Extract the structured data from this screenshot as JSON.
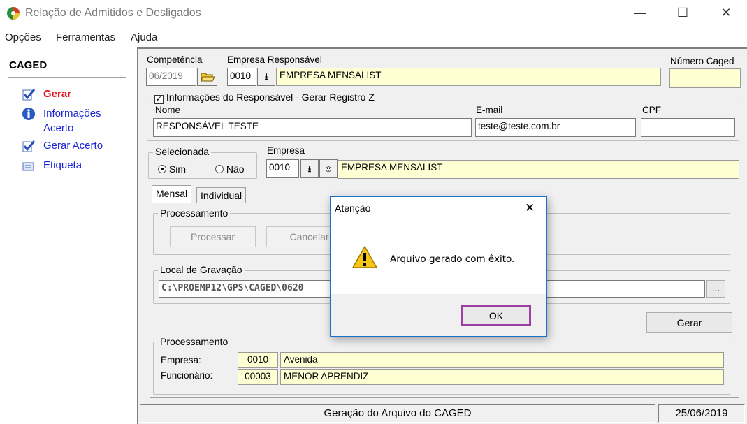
{
  "window": {
    "title": "Relação de Admitidos e Desligados",
    "minimize": "—",
    "maximize": "☐",
    "close": "✕"
  },
  "menu": [
    "Opções",
    "Ferramentas",
    "Ajuda"
  ],
  "sidebar": {
    "title": "CAGED",
    "items": [
      {
        "label": "Gerar",
        "color": "#e0121b"
      },
      {
        "label": "Informações",
        "label2": "Acerto"
      },
      {
        "label": "Gerar Acerto"
      },
      {
        "label": "Etiqueta"
      }
    ]
  },
  "form": {
    "competencia_label": "Competência",
    "competencia_value": "06/2019",
    "empresa_resp_label": "Empresa Responsável",
    "empresa_resp_code": "0010",
    "empresa_resp_name": "EMPRESA MENSALIST",
    "numero_caged_label": "Número Caged",
    "numero_caged_value": "",
    "info_resp_checkbox": "✓",
    "info_resp_label": "Informações do Responsável - Gerar Registro Z",
    "nome_label": "Nome",
    "nome_value": "RESPONSÁVEL TESTE",
    "email_label": "E-mail",
    "email_value": "teste@teste.com.br",
    "cpf_label": "CPF",
    "cpf_value": "",
    "selecionada_label": "Selecionada",
    "sim_label": "Sim",
    "nao_label": "Não",
    "empresa_label": "Empresa",
    "empresa_code": "0010",
    "empresa_name": "EMPRESA MENSALIST"
  },
  "tabs": [
    "Mensal",
    "Individual"
  ],
  "processamento": {
    "title": "Processamento",
    "processar": "Processar",
    "cancelar": "Cancelar"
  },
  "local": {
    "title": "Local de Gravação",
    "path": "C:\\PROEMP12\\GPS\\CAGED\\0620",
    "browse": "..."
  },
  "gerar_button": "Gerar",
  "processamento2": {
    "title": "Processamento",
    "empresa_label": "Empresa:",
    "empresa_code": "0010",
    "empresa_name": "Avenida",
    "func_label": "Funcionário:",
    "func_code": "00003",
    "func_name": "MENOR APRENDIZ"
  },
  "status": {
    "message": "Geração do Arquivo do CAGED",
    "date": "25/06/2019"
  },
  "dialog": {
    "title": "Atenção",
    "close": "✕",
    "message": "Arquivo gerado com êxito.",
    "ok": "OK"
  }
}
